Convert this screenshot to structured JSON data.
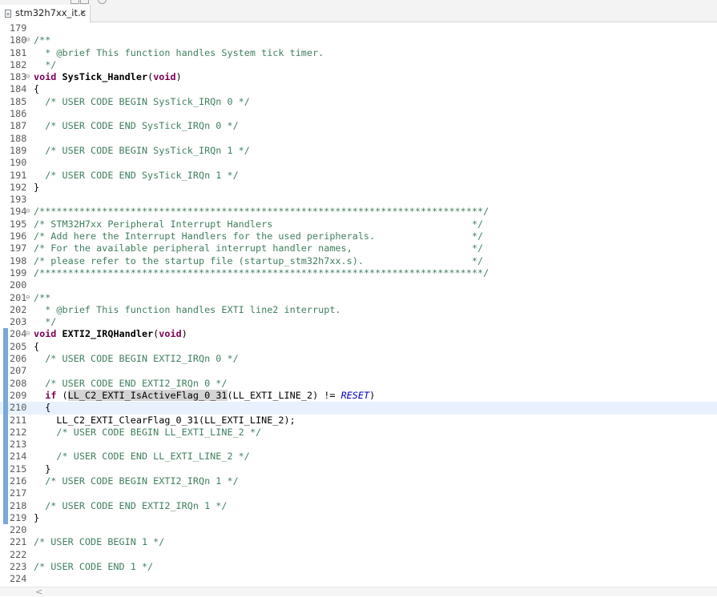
{
  "tab": {
    "label": "stm32h7xx_it.c",
    "close_glyph": "×",
    "icon": "c-file-icon"
  },
  "lines": [
    {
      "num": "179",
      "segs": []
    },
    {
      "num": "180",
      "fold": true,
      "segs": [
        {
          "t": "cm",
          "v": "/**"
        }
      ]
    },
    {
      "num": "181",
      "segs": [
        {
          "t": "cm",
          "v": "  * @brief This function handles System tick timer."
        }
      ]
    },
    {
      "num": "182",
      "segs": [
        {
          "t": "cm",
          "v": "  */"
        }
      ]
    },
    {
      "num": "183",
      "fold": true,
      "segs": [
        {
          "t": "kw",
          "v": "void"
        },
        {
          "t": "",
          "v": " "
        },
        {
          "t": "fn",
          "v": "SysTick_Handler"
        },
        {
          "t": "",
          "v": "("
        },
        {
          "t": "kw",
          "v": "void"
        },
        {
          "t": "",
          "v": ")"
        }
      ]
    },
    {
      "num": "184",
      "segs": [
        {
          "t": "",
          "v": "{"
        }
      ]
    },
    {
      "num": "185",
      "segs": [
        {
          "t": "cm",
          "v": "  /* USER CODE BEGIN SysTick_IRQn 0 */"
        }
      ]
    },
    {
      "num": "186",
      "segs": []
    },
    {
      "num": "187",
      "segs": [
        {
          "t": "cm",
          "v": "  /* USER CODE END SysTick_IRQn 0 */"
        }
      ]
    },
    {
      "num": "188",
      "segs": []
    },
    {
      "num": "189",
      "segs": [
        {
          "t": "cm",
          "v": "  /* USER CODE BEGIN SysTick_IRQn 1 */"
        }
      ]
    },
    {
      "num": "190",
      "segs": []
    },
    {
      "num": "191",
      "segs": [
        {
          "t": "cm",
          "v": "  /* USER CODE END SysTick_IRQn 1 */"
        }
      ]
    },
    {
      "num": "192",
      "segs": [
        {
          "t": "",
          "v": "}"
        }
      ]
    },
    {
      "num": "193",
      "segs": []
    },
    {
      "num": "194",
      "fold": true,
      "segs": [
        {
          "t": "cm",
          "v": "/******************************************************************************/"
        }
      ]
    },
    {
      "num": "195",
      "segs": [
        {
          "t": "cm",
          "v": "/* STM32H7xx Peripheral Interrupt Handlers                                   */"
        }
      ]
    },
    {
      "num": "196",
      "segs": [
        {
          "t": "cm",
          "v": "/* Add here the Interrupt Handlers for the used peripherals.                 */"
        }
      ]
    },
    {
      "num": "197",
      "segs": [
        {
          "t": "cm",
          "v": "/* For the available peripheral interrupt handler names,                     */"
        }
      ]
    },
    {
      "num": "198",
      "segs": [
        {
          "t": "cm",
          "v": "/* please refer to the startup file (startup_stm32h7xx.s).                   */"
        }
      ]
    },
    {
      "num": "199",
      "segs": [
        {
          "t": "cm",
          "v": "/******************************************************************************/"
        }
      ]
    },
    {
      "num": "200",
      "segs": []
    },
    {
      "num": "201",
      "fold": true,
      "segs": [
        {
          "t": "cm",
          "v": "/**"
        }
      ]
    },
    {
      "num": "202",
      "segs": [
        {
          "t": "cm",
          "v": "  * @brief This function handles EXTI line2 interrupt."
        }
      ]
    },
    {
      "num": "203",
      "segs": [
        {
          "t": "cm",
          "v": "  */"
        }
      ]
    },
    {
      "num": "204",
      "fold": true,
      "mark": true,
      "segs": [
        {
          "t": "kw",
          "v": "void"
        },
        {
          "t": "",
          "v": " "
        },
        {
          "t": "fn",
          "v": "EXTI2_IRQHandler"
        },
        {
          "t": "",
          "v": "("
        },
        {
          "t": "kw",
          "v": "void"
        },
        {
          "t": "",
          "v": ")"
        }
      ]
    },
    {
      "num": "205",
      "mark": true,
      "segs": [
        {
          "t": "",
          "v": "{"
        }
      ]
    },
    {
      "num": "206",
      "mark": true,
      "segs": [
        {
          "t": "cm",
          "v": "  /* USER CODE BEGIN EXTI2_IRQn 0 */"
        }
      ]
    },
    {
      "num": "207",
      "mark": true,
      "segs": []
    },
    {
      "num": "208",
      "mark": true,
      "segs": [
        {
          "t": "cm",
          "v": "  /* USER CODE END EXTI2_IRQn 0 */"
        }
      ]
    },
    {
      "num": "209",
      "mark": true,
      "segs": [
        {
          "t": "",
          "v": "  "
        },
        {
          "t": "kw",
          "v": "if"
        },
        {
          "t": "",
          "v": " ("
        },
        {
          "t": "hl",
          "v": "LL_C2_EXTI_IsActiveFlag_0_31"
        },
        {
          "t": "",
          "v": "(LL_EXTI_LINE_2) != "
        },
        {
          "t": "ci",
          "v": "RESET"
        },
        {
          "t": "",
          "v": ")"
        }
      ]
    },
    {
      "num": "210",
      "mark": true,
      "current": true,
      "segs": [
        {
          "t": "",
          "v": "  {"
        }
      ]
    },
    {
      "num": "211",
      "mark": true,
      "segs": [
        {
          "t": "",
          "v": "    LL_C2_EXTI_ClearFlag_0_31(LL_EXTI_LINE_2);"
        }
      ]
    },
    {
      "num": "212",
      "mark": true,
      "segs": [
        {
          "t": "cm",
          "v": "    /* USER CODE BEGIN LL_EXTI_LINE_2 */"
        }
      ]
    },
    {
      "num": "213",
      "mark": true,
      "segs": []
    },
    {
      "num": "214",
      "mark": true,
      "segs": [
        {
          "t": "cm",
          "v": "    /* USER CODE END LL_EXTI_LINE_2 */"
        }
      ]
    },
    {
      "num": "215",
      "mark": true,
      "segs": [
        {
          "t": "",
          "v": "  }"
        }
      ]
    },
    {
      "num": "216",
      "mark": true,
      "segs": [
        {
          "t": "cm",
          "v": "  /* USER CODE BEGIN EXTI2_IRQn 1 */"
        }
      ]
    },
    {
      "num": "217",
      "mark": true,
      "segs": []
    },
    {
      "num": "218",
      "mark": true,
      "segs": [
        {
          "t": "cm",
          "v": "  /* USER CODE END EXTI2_IRQn 1 */"
        }
      ]
    },
    {
      "num": "219",
      "mark": true,
      "segs": [
        {
          "t": "",
          "v": "}"
        }
      ]
    },
    {
      "num": "220",
      "segs": []
    },
    {
      "num": "221",
      "segs": [
        {
          "t": "cm",
          "v": "/* USER CODE BEGIN 1 */"
        }
      ]
    },
    {
      "num": "222",
      "segs": []
    },
    {
      "num": "223",
      "segs": [
        {
          "t": "cm",
          "v": "/* USER CODE END 1 */"
        }
      ]
    },
    {
      "num": "224",
      "segs": []
    }
  ],
  "fold_glyph": "⊖",
  "scroll_left_glyph": "<",
  "colors": {
    "comment": "#3f7f5f",
    "keyword": "#7f0055",
    "constant": "#0000c0",
    "current_line": "#e8f2fe",
    "change_marker": "#7ba7d9"
  }
}
